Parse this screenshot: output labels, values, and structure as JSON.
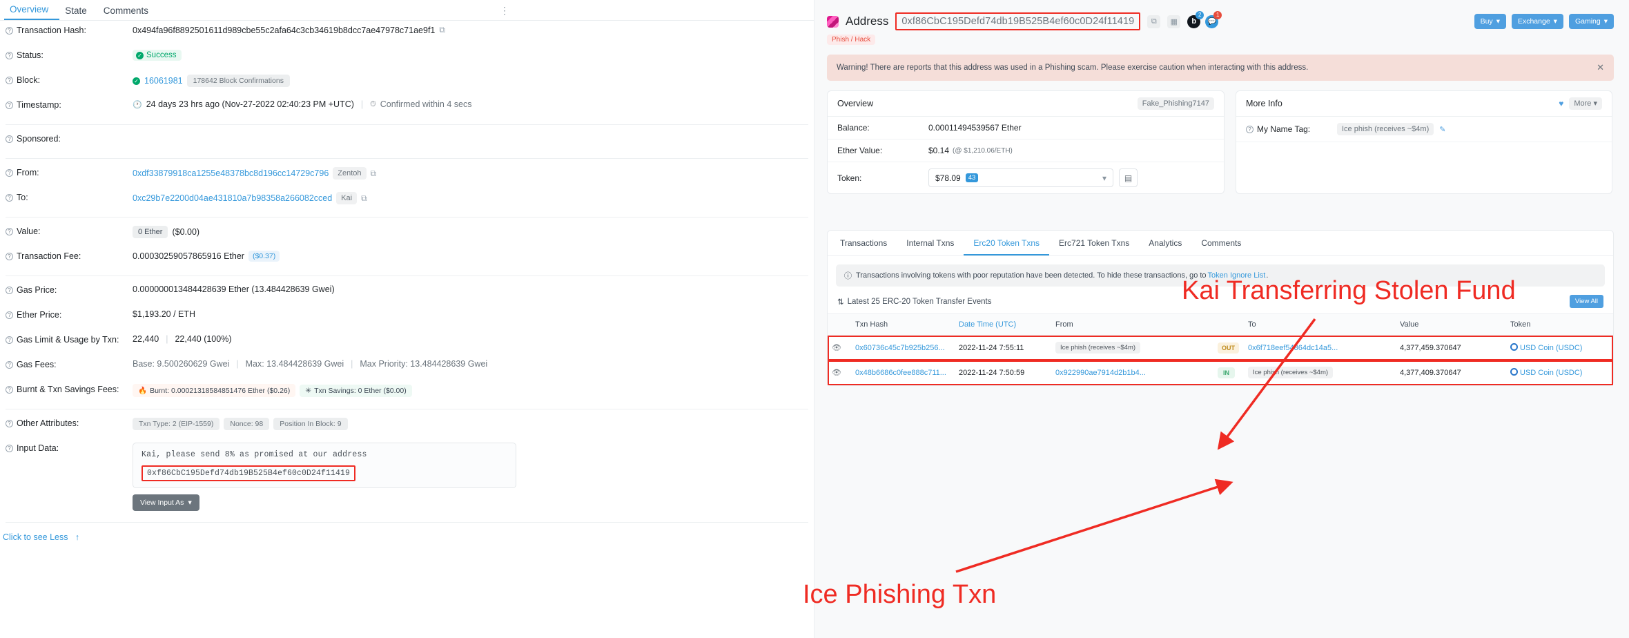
{
  "left": {
    "tabs": [
      {
        "label": "Overview",
        "active": true
      },
      {
        "label": "State",
        "active": false
      },
      {
        "label": "Comments",
        "active": false
      }
    ],
    "kebab": "⋮",
    "rows": {
      "txn_hash_label": "Transaction Hash:",
      "txn_hash_value": "0x494fa96f8892501611d989cbe55c2afa64c3cb34619b8dcc7ae47978c71ae9f1",
      "status_label": "Status:",
      "status_value": "Success",
      "block_label": "Block:",
      "block_value": "16061981",
      "block_confirmations": "178642 Block Confirmations",
      "timestamp_label": "Timestamp:",
      "timestamp_value": "24 days 23 hrs ago (Nov-27-2022 02:40:23 PM +UTC)",
      "timestamp_confirm": "Confirmed within 4 secs",
      "sponsored_label": "Sponsored:",
      "from_label": "From:",
      "from_value": "0xdf33879918ca1255e48378bc8d196cc14729c796",
      "from_tag": "Zentoh",
      "to_label": "To:",
      "to_value": "0xc29b7e2200d04ae431810a7b98358a266082cced",
      "to_tag": "Kai",
      "value_label": "Value:",
      "value_eth": "0 Ether",
      "value_usd": "($0.00)",
      "txn_fee_label": "Transaction Fee:",
      "txn_fee_value": "0.00030259057865916 Ether",
      "txn_fee_usd": "($0.37)",
      "gas_price_label": "Gas Price:",
      "gas_price_value": "0.000000013484428639 Ether (13.484428639 Gwei)",
      "ether_price_label": "Ether Price:",
      "ether_price_value": "$1,193.20 / ETH",
      "gas_limit_label": "Gas Limit & Usage by Txn:",
      "gas_limit_value": "22,440",
      "gas_used_value": "22,440 (100%)",
      "gas_fees_label": "Gas Fees:",
      "gas_fees_base": "Base: 9.500260629 Gwei",
      "gas_fees_max": "Max: 13.484428639 Gwei",
      "gas_fees_priority": "Max Priority: 13.484428639 Gwei",
      "burnt_label": "Burnt & Txn Savings Fees:",
      "burnt_value": "Burnt: 0.00021318584851476 Ether ($0.26)",
      "savings_value": "Txn Savings: 0 Ether ($0.00)",
      "other_attr_label": "Other Attributes:",
      "txn_type": "Txn Type: 2 (EIP-1559)",
      "nonce": "Nonce: 98",
      "position": "Position In Block: 9",
      "input_data_label": "Input Data:",
      "input_line1": "Kai, please send 8% as promised at our address",
      "input_line2": "0xf86CbC195Defd74db19B525B4ef60c0D24f11419",
      "view_input_as": "View Input As",
      "see_less": "Click to see Less"
    }
  },
  "right": {
    "header": {
      "title": "Address",
      "address": "0xf86CbC195Defd74db19B525B4ef60c0D24f11419",
      "phish_tag": "Phish / Hack",
      "copy_icon": "copy-icon",
      "qr_icon": "qr-icon",
      "blockscan_badge": "2",
      "chat_badge": "1",
      "buttons": [
        {
          "label": "Buy"
        },
        {
          "label": "Exchange"
        },
        {
          "label": "Gaming"
        }
      ]
    },
    "warning": "Warning! There are reports that this address was used in a Phishing scam. Please exercise caution when interacting with this address.",
    "overview": {
      "title": "Overview",
      "name_tag": "Fake_Phishing7147",
      "balance_label": "Balance:",
      "balance_value": "0.00011494539567 Ether",
      "ether_value_label": "Ether Value:",
      "ether_value": "$0.14",
      "ether_value_rate": "(@ $1,210.06/ETH)",
      "token_label": "Token:",
      "token_value": "$78.09",
      "token_count": "43"
    },
    "more_info": {
      "title": "More Info",
      "more_label": "More",
      "name_tag_label": "My Name Tag:",
      "name_tag_value": "Ice phish (receives ~$4m)"
    },
    "tabs": [
      {
        "label": "Transactions",
        "active": false
      },
      {
        "label": "Internal Txns",
        "active": false
      },
      {
        "label": "Erc20 Token Txns",
        "active": true
      },
      {
        "label": "Erc721 Token Txns",
        "active": false
      },
      {
        "label": "Analytics",
        "active": false
      },
      {
        "label": "Comments",
        "active": false
      }
    ],
    "info_strip": {
      "text": "Transactions involving tokens with poor reputation have been detected. To hide these transactions, go to ",
      "link": "Token Ignore List",
      "suffix": "."
    },
    "latest_label": "Latest 25 ERC-20 Token Transfer Events",
    "view_all": "View All",
    "table": {
      "columns": [
        "",
        "Txn Hash",
        "Date Time (UTC)",
        "From",
        "",
        "To",
        "Value",
        "Token"
      ],
      "rows": [
        {
          "txn_hash": "0x60736c45c7b925b256...",
          "datetime": "2022-11-24 7:55:11",
          "from": "Ice phish (receives ~$4m)",
          "from_is_tag": true,
          "direction": "OUT",
          "to": "0x6f718eef54864dc14a5...",
          "to_is_tag": false,
          "value": "4,377,459.370647",
          "token": "USD Coin (USDC)"
        },
        {
          "txn_hash": "0x48b6686c0fee888c711...",
          "datetime": "2022-11-24 7:50:59",
          "from": "0x922990ae7914d2b1b4...",
          "from_is_tag": false,
          "direction": "IN",
          "to": "Ice phish (receives ~$4m)",
          "to_is_tag": true,
          "value": "4,377,409.370647",
          "token": "USD Coin (USDC)"
        }
      ]
    }
  },
  "annotations": {
    "top": "Kai Transferring Stolen Fund",
    "bottom": "Ice Phishing Txn",
    "color": "#ef2b23"
  }
}
